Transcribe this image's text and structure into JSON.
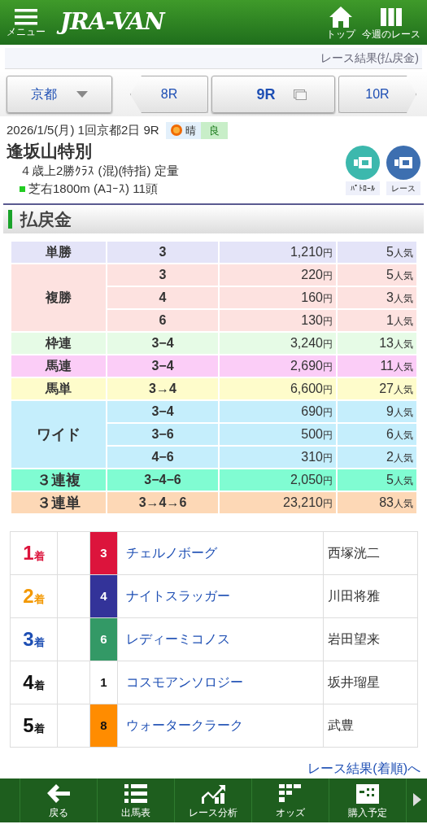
{
  "header": {
    "menu_label": "メニュー",
    "logo": "JRA-VAN",
    "nav": [
      {
        "kind": "home",
        "label": "トップ"
      },
      {
        "kind": "week",
        "label": "今週のレース"
      }
    ]
  },
  "breadcrumb": "レース結果(払戻金)",
  "venue_select": "京都",
  "race_tabs": [
    {
      "kind": "prev",
      "label": "8R",
      "selected": false
    },
    {
      "kind": "current",
      "label": "9R",
      "selected": true
    },
    {
      "kind": "next",
      "label": "10R",
      "selected": false
    }
  ],
  "race_info": {
    "date_line": "2026/1/5(月) 1回京都2日 9R",
    "weather": "晴",
    "track_condition": "良",
    "name": "逢坂山特別",
    "conditions": "４歳上2勝ｸﾗｽ (混)(特指) 定量",
    "course": "芝右1800m (Aｺｰｽ) 11頭"
  },
  "video_buttons": [
    {
      "label": "ﾊﾟﾄﾛｰﾙ",
      "color": "#3cb8ad"
    },
    {
      "label": "レース",
      "color": "#3d6fb0"
    }
  ],
  "section_title": "払戻金",
  "payouts": [
    {
      "bet": "単勝",
      "color": "#e4e4f8",
      "rows": [
        {
          "combo": "3",
          "amount": "1,210",
          "yen": "円",
          "popularity": "5",
          "pop_unit": "人気"
        }
      ]
    },
    {
      "bet": "複勝",
      "color": "#fde2e0",
      "rows": [
        {
          "combo": "3",
          "amount": "220",
          "yen": "円",
          "popularity": "5",
          "pop_unit": "人気"
        },
        {
          "combo": "4",
          "amount": "160",
          "yen": "円",
          "popularity": "3",
          "pop_unit": "人気"
        },
        {
          "combo": "6",
          "amount": "130",
          "yen": "円",
          "popularity": "1",
          "pop_unit": "人気"
        }
      ]
    },
    {
      "bet": "枠連",
      "color": "#e6fbe6",
      "rows": [
        {
          "combo": "3−4",
          "amount": "3,240",
          "yen": "円",
          "popularity": "13",
          "pop_unit": "人気"
        }
      ]
    },
    {
      "bet": "馬連",
      "color": "#fbcdf7",
      "rows": [
        {
          "combo": "3−4",
          "amount": "2,690",
          "yen": "円",
          "popularity": "11",
          "pop_unit": "人気"
        }
      ]
    },
    {
      "bet": "馬単",
      "color": "#fefccb",
      "rows": [
        {
          "combo": "3→4",
          "amount": "6,600",
          "yen": "円",
          "popularity": "27",
          "pop_unit": "人気"
        }
      ]
    },
    {
      "bet": "ワイド",
      "color": "#c5eefc",
      "rows": [
        {
          "combo": "3−4",
          "amount": "690",
          "yen": "円",
          "popularity": "9",
          "pop_unit": "人気"
        },
        {
          "combo": "3−6",
          "amount": "500",
          "yen": "円",
          "popularity": "6",
          "pop_unit": "人気"
        },
        {
          "combo": "4−6",
          "amount": "310",
          "yen": "円",
          "popularity": "2",
          "pop_unit": "人気"
        }
      ]
    },
    {
      "bet": "３連複",
      "color": "#80fcd2",
      "rows": [
        {
          "combo": "3−4−6",
          "amount": "2,050",
          "yen": "円",
          "popularity": "5",
          "pop_unit": "人気"
        }
      ]
    },
    {
      "bet": "３連単",
      "color": "#fdd8b6",
      "rows": [
        {
          "combo": "3→4→6",
          "amount": "23,210",
          "yen": "円",
          "popularity": "83",
          "pop_unit": "人気"
        }
      ]
    }
  ],
  "results": [
    {
      "place": {
        "text": "1",
        "suffix": "着",
        "color": "#dc143c"
      },
      "frame": {
        "number": "3",
        "color": "#dc143c"
      },
      "horse": "チェルノボーグ",
      "jockey": "西塚洸二"
    },
    {
      "place": {
        "text": "2",
        "suffix": "着",
        "color": "#f39800"
      },
      "frame": {
        "number": "4",
        "color": "#333399"
      },
      "horse": "ナイトスラッガー",
      "jockey": "川田将雅"
    },
    {
      "place": {
        "text": "3",
        "suffix": "着",
        "color": "#1e4fb4"
      },
      "frame": {
        "number": "6",
        "color": "#339966"
      },
      "horse": "レディーミコノス",
      "jockey": "岩田望来"
    },
    {
      "place": {
        "text": "4",
        "suffix": "着",
        "color": "#111111"
      },
      "frame": {
        "number": "1",
        "color": "#ffffff"
      },
      "horse": "コスモアンソロジー",
      "jockey": "坂井瑠星"
    },
    {
      "place": {
        "text": "5",
        "suffix": "着",
        "color": "#111111"
      },
      "frame": {
        "number": "8",
        "color": "#ff8c00"
      },
      "horse": "ウォータークラーク",
      "jockey": "武豊"
    }
  ],
  "results_link": "レース結果(着順)へ",
  "bottom_nav": [
    {
      "kind": "back",
      "label": "戻る"
    },
    {
      "kind": "list",
      "label": "出馬表"
    },
    {
      "kind": "chart",
      "label": "レース分析"
    },
    {
      "kind": "odds",
      "label": "オッズ"
    },
    {
      "kind": "plan",
      "label": "購入予定"
    }
  ]
}
